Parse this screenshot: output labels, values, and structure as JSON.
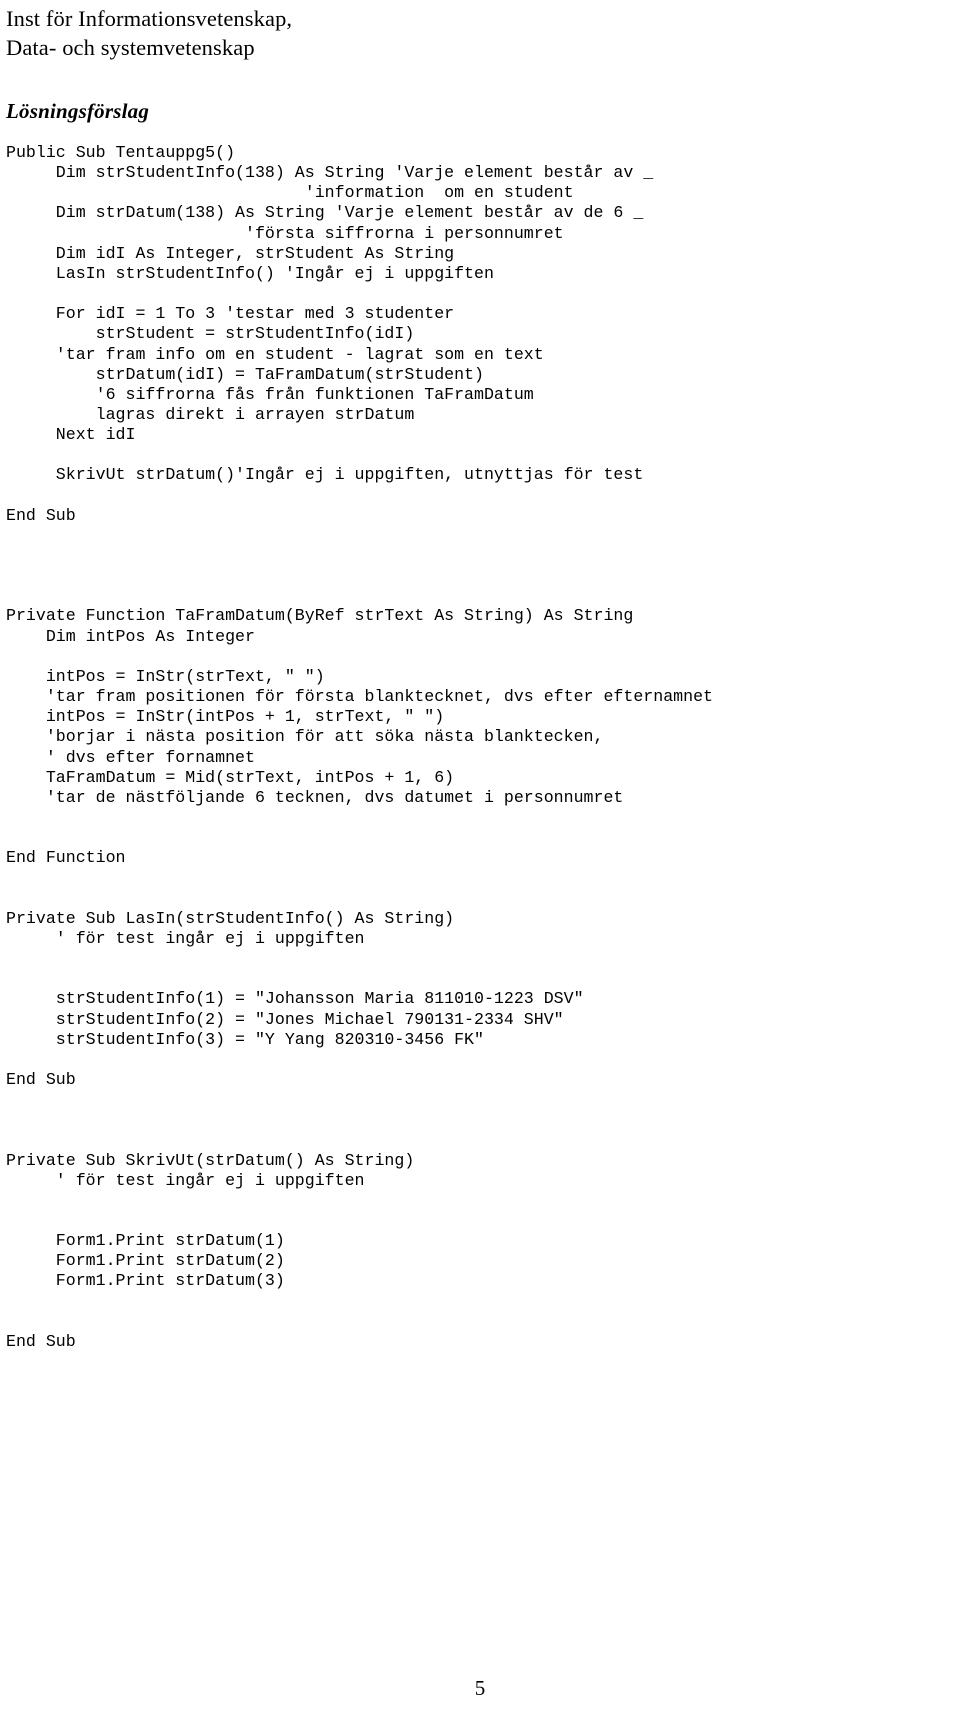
{
  "header": {
    "line1": "Inst för Informationsvetenskap,",
    "line2": "Data- och systemvetenskap"
  },
  "section": {
    "title": "Lösningsförslag"
  },
  "page": {
    "number": "5"
  },
  "code": {
    "lines": [
      "Public Sub Tentauppg5()",
      "     Dim strStudentInfo(138) As String 'Varje element består av _",
      "                              'information  om en student",
      "     Dim strDatum(138) As String 'Varje element består av de 6 _",
      "                        'första siffrorna i personnumret",
      "     Dim idI As Integer, strStudent As String",
      "     LasIn strStudentInfo() 'Ingår ej i uppgiften",
      "",
      "     For idI = 1 To 3 'testar med 3 studenter",
      "         strStudent = strStudentInfo(idI)",
      "     'tar fram info om en student - lagrat som en text",
      "         strDatum(idI) = TaFramDatum(strStudent)",
      "         '6 siffrorna fås från funktionen TaFramDatum",
      "         lagras direkt i arrayen strDatum",
      "     Next idI",
      "",
      "     SkrivUt strDatum()'Ingår ej i uppgiften, utnyttjas för test",
      "",
      "End Sub",
      "",
      "",
      "",
      "",
      "Private Function TaFramDatum(ByRef strText As String) As String",
      "    Dim intPos As Integer",
      "",
      "    intPos = InStr(strText, \" \")",
      "    'tar fram positionen för första blanktecknet, dvs efter efternamnet",
      "    intPos = InStr(intPos + 1, strText, \" \")",
      "    'borjar i nästa position för att söka nästa blanktecken,",
      "    ' dvs efter fornamnet",
      "    TaFramDatum = Mid(strText, intPos + 1, 6)",
      "    'tar de nästföljande 6 tecknen, dvs datumet i personnumret",
      "",
      "",
      "End Function",
      "",
      "",
      "Private Sub LasIn(strStudentInfo() As String)",
      "     ' för test ingår ej i uppgiften",
      "",
      "",
      "     strStudentInfo(1) = \"Johansson Maria 811010-1223 DSV\"",
      "     strStudentInfo(2) = \"Jones Michael 790131-2334 SHV\"",
      "     strStudentInfo(3) = \"Y Yang 820310-3456 FK\"",
      "",
      "End Sub",
      "",
      "",
      "",
      "Private Sub SkrivUt(strDatum() As String)",
      "     ' för test ingår ej i uppgiften",
      "",
      "",
      "     Form1.Print strDatum(1)",
      "     Form1.Print strDatum(2)",
      "     Form1.Print strDatum(3)",
      "",
      "",
      "End Sub"
    ]
  }
}
